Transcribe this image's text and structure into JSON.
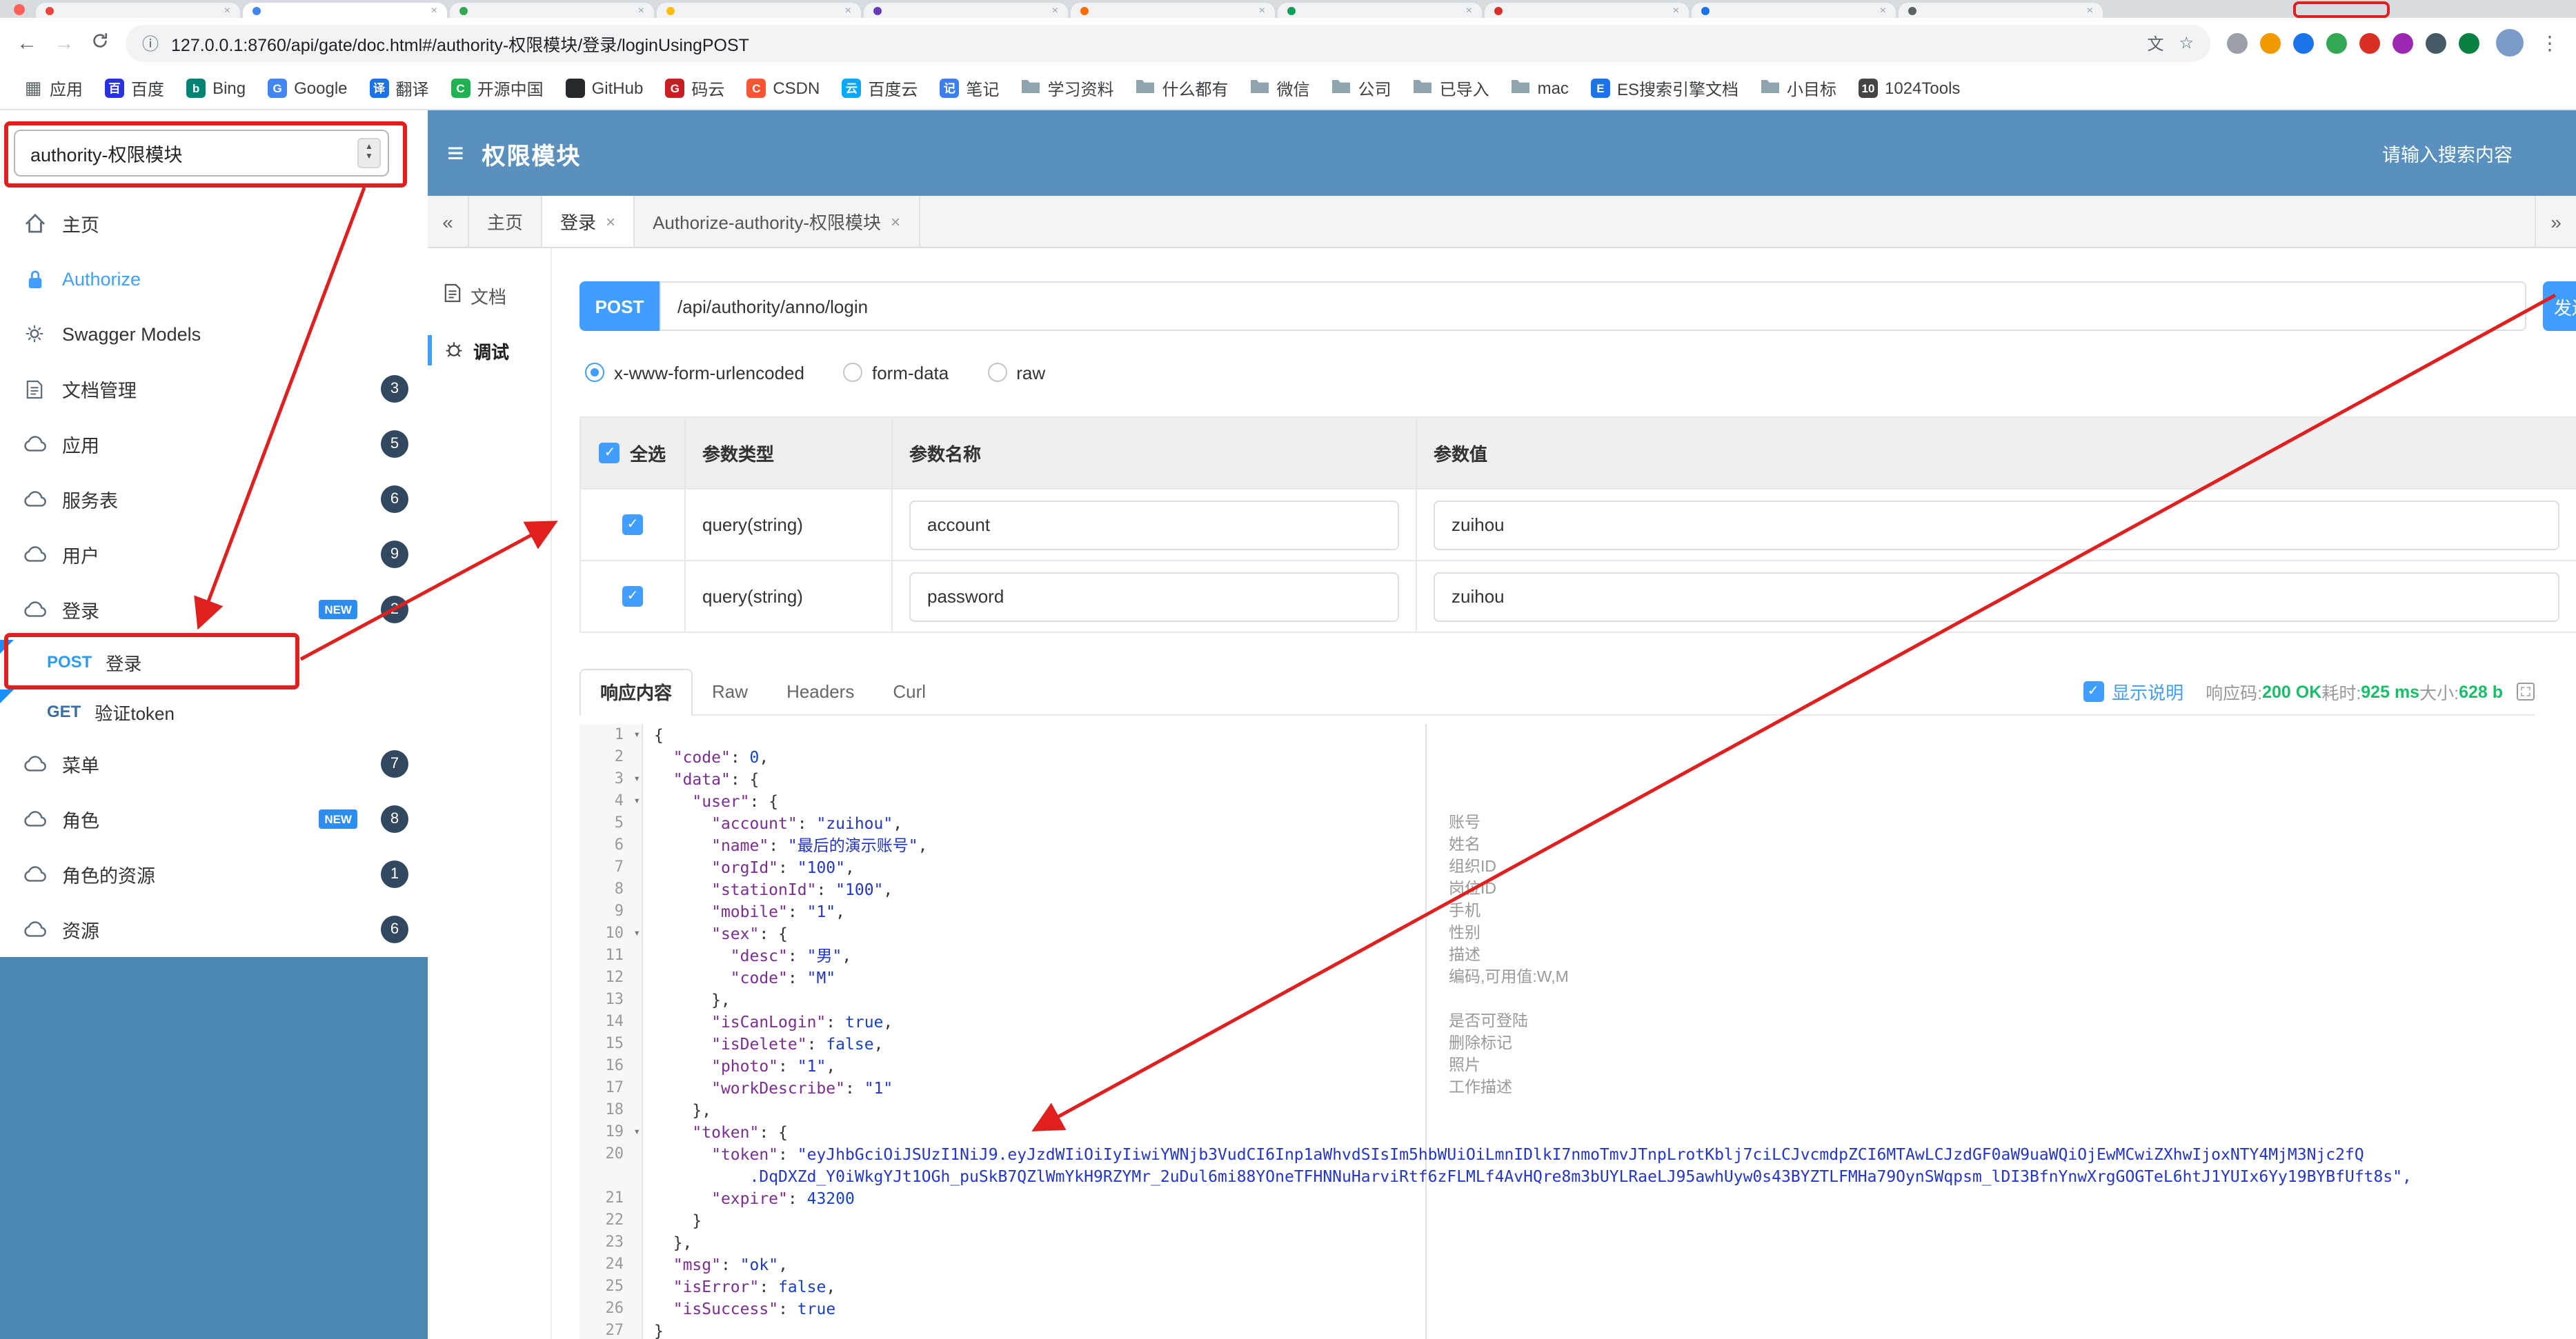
{
  "ui": {
    "burger": "≡",
    "collapse": "«",
    "expand": "»",
    "close": "×",
    "fold": "▾",
    "check": "✓",
    "back": "←",
    "forward": "→",
    "info": "ⓘ",
    "star": "☆",
    "translate": "文",
    "menu": "⋮",
    "apps": "▦",
    "spin_up": "▲",
    "spin_down": "▼"
  },
  "browser": {
    "url": "127.0.0.1:8760/api/gate/doc.html#/authority-权限模块/登录/loginUsingPOST",
    "bookmarks": [
      {
        "label": "应用",
        "icon": "grid"
      },
      {
        "label": "百度",
        "icon": "glyph",
        "bg": "#2932e1",
        "ch": "百"
      },
      {
        "label": "Bing",
        "icon": "glyph",
        "bg": "#008373",
        "ch": "b"
      },
      {
        "label": "Google",
        "icon": "glyph",
        "bg": "#4285f4",
        "ch": "G"
      },
      {
        "label": "翻译",
        "icon": "glyph",
        "bg": "#1a73e8",
        "ch": "译"
      },
      {
        "label": "开源中国",
        "icon": "glyph",
        "bg": "#21b351",
        "ch": "C"
      },
      {
        "label": "GitHub",
        "icon": "glyph",
        "bg": "#24292e",
        "ch": ""
      },
      {
        "label": "码云",
        "icon": "glyph",
        "bg": "#c71d23",
        "ch": "G"
      },
      {
        "label": "CSDN",
        "icon": "glyph",
        "bg": "#fc5531",
        "ch": "C"
      },
      {
        "label": "百度云",
        "icon": "glyph",
        "bg": "#06a7ff",
        "ch": "云"
      },
      {
        "label": "笔记",
        "icon": "glyph",
        "bg": "#3b7ff0",
        "ch": "记"
      },
      {
        "label": "学习资料",
        "icon": "folder"
      },
      {
        "label": "什么都有",
        "icon": "folder"
      },
      {
        "label": "微信",
        "icon": "folder"
      },
      {
        "label": "公司",
        "icon": "folder"
      },
      {
        "label": "已导入",
        "icon": "folder"
      },
      {
        "label": "mac",
        "icon": "folder"
      },
      {
        "label": "ES搜索引擎文档",
        "icon": "glyph",
        "bg": "#1a73e8",
        "ch": "E"
      },
      {
        "label": "小目标",
        "icon": "folder"
      },
      {
        "label": "1024Tools",
        "icon": "glyph",
        "bg": "#444444",
        "ch": "10"
      }
    ]
  },
  "header": {
    "group": "authority-权限模块",
    "title": "权限模块",
    "search_placeholder": "请输入搜索内容"
  },
  "sidebar": {
    "new_label": "NEW",
    "items": [
      {
        "label": "主页",
        "icon": "home"
      },
      {
        "label": "Authorize",
        "icon": "lock",
        "auth": true
      },
      {
        "label": "Swagger Models",
        "icon": "models"
      },
      {
        "label": "文档管理",
        "icon": "doc",
        "badge": "3"
      },
      {
        "label": "应用",
        "icon": "cloud",
        "badge": "5"
      },
      {
        "label": "服务表",
        "icon": "cloud",
        "badge": "6"
      },
      {
        "label": "用户",
        "icon": "cloud",
        "badge": "9"
      },
      {
        "label": "登录",
        "icon": "cloud",
        "badge": "2",
        "new": true
      },
      {
        "sub": true,
        "method": "POST",
        "label": "登录",
        "marker": true
      },
      {
        "sub": true,
        "method": "GET",
        "label": "验证token",
        "marker": true
      },
      {
        "label": "菜单",
        "icon": "cloud",
        "badge": "7"
      },
      {
        "label": "角色",
        "icon": "cloud",
        "badge": "8",
        "new": true
      },
      {
        "label": "角色的资源",
        "icon": "cloud",
        "badge": "1"
      },
      {
        "label": "资源",
        "icon": "cloud",
        "badge": "6"
      }
    ]
  },
  "content_tabs": {
    "items": [
      {
        "label": "主页"
      },
      {
        "label": "登录",
        "closable": true,
        "active": true
      },
      {
        "label": "Authorize-authority-权限模块",
        "closable": true
      }
    ]
  },
  "doc_nav": {
    "items": [
      {
        "label": "文档",
        "icon": "docpage"
      },
      {
        "label": "调试",
        "icon": "debug",
        "active": true
      }
    ]
  },
  "debug": {
    "method": "POST",
    "url": "/api/authority/anno/login",
    "send_label": "发送",
    "content_types": [
      {
        "label": "x-www-form-urlencoded",
        "selected": true
      },
      {
        "label": "form-data"
      },
      {
        "label": "raw"
      }
    ],
    "params": {
      "select_all": "全选",
      "headers": [
        "参数类型",
        "参数名称",
        "参数值"
      ],
      "rows": [
        {
          "checked": true,
          "type": "query(string)",
          "name": "account",
          "value": "zuihou"
        },
        {
          "checked": true,
          "type": "query(string)",
          "name": "password",
          "value": "zuihou"
        }
      ]
    }
  },
  "response": {
    "tabs": [
      {
        "label": "响应内容",
        "active": true
      },
      {
        "label": "Raw"
      },
      {
        "label": "Headers"
      },
      {
        "label": "Curl"
      }
    ],
    "show_desc": "显示说明",
    "status_label": "响应码:",
    "status": "200 OK",
    "time_label": "耗时:",
    "time": "925 ms",
    "size_label": "大小:",
    "size": "628 b"
  },
  "code": {
    "lines": [
      {
        "n": 1,
        "t": "{",
        "fold": true
      },
      {
        "n": 2,
        "t": "  \"code\": 0,"
      },
      {
        "n": 3,
        "t": "  \"data\": {",
        "fold": true
      },
      {
        "n": 4,
        "t": "    \"user\": {",
        "fold": true
      },
      {
        "n": 5,
        "t": "      \"account\": \"zuihou\",",
        "c": "账号"
      },
      {
        "n": 6,
        "t": "      \"name\": \"最后的演示账号\",",
        "c": "姓名"
      },
      {
        "n": 7,
        "t": "      \"orgId\": \"100\",",
        "c": "组织ID"
      },
      {
        "n": 8,
        "t": "      \"stationId\": \"100\",",
        "c": "岗位ID"
      },
      {
        "n": 9,
        "t": "      \"mobile\": \"1\",",
        "c": "手机"
      },
      {
        "n": 10,
        "t": "      \"sex\": {",
        "fold": true,
        "c": "性别"
      },
      {
        "n": 11,
        "t": "        \"desc\": \"男\",",
        "c": "描述"
      },
      {
        "n": 12,
        "t": "        \"code\": \"M\"",
        "c": "编码,可用值:W,M"
      },
      {
        "n": 13,
        "t": "      },"
      },
      {
        "n": 14,
        "t": "      \"isCanLogin\": true,",
        "c": "是否可登陆"
      },
      {
        "n": 15,
        "t": "      \"isDelete\": false,",
        "c": "删除标记"
      },
      {
        "n": 16,
        "t": "      \"photo\": \"1\",",
        "c": "照片"
      },
      {
        "n": 17,
        "t": "      \"workDescribe\": \"1\"",
        "c": "工作描述"
      },
      {
        "n": 18,
        "t": "    },"
      },
      {
        "n": 19,
        "t": "    \"token\": {",
        "fold": true
      },
      {
        "n": 20,
        "seg": [
          {
            "t": "      "
          },
          {
            "t": "\"token\"",
            "cls": "ck"
          },
          {
            "t": ": "
          },
          {
            "t": "\"eyJhbGciOiJSUzI1NiJ9.eyJzdWIiOiIyIiwiYWNjb3VudCI6Inp1aWhvdSIsIm5hbWUiOiLmnIDlkI7nmoTmvJTnpLrotKblj7ciLCJvcmdpZCI6MTAwLCJzdGF0aW9uaWQiOjEwMCwiZXhwIjoxNTY4MjM3Njc2fQ",
            "cls": "cs"
          }
        ]
      },
      {
        "n": "",
        "seg": [
          {
            "t": "          "
          },
          {
            "t": ".DqDXZd_Y0iWkgYJt1OGh_puSkB7QZlWmYkH9RZYMr_2uDul6mi88YOneTFHNNuHarviRtf6zFLMLf4AvHQre8m3bUYLRaeLJ95awhUyw0s43BYZTLFMHa79OynSWqpsm_lDI3BfnYnwXrgGOGTeL6htJ1YUIx6Yy19BYBfUft8s\",",
            "cls": "cs"
          }
        ]
      },
      {
        "n": 21,
        "t": "      \"expire\": 43200"
      },
      {
        "n": 22,
        "t": "    }"
      },
      {
        "n": 23,
        "t": "  },"
      },
      {
        "n": 24,
        "t": "  \"msg\": \"ok\","
      },
      {
        "n": 25,
        "t": "  \"isError\": false,"
      },
      {
        "n": 26,
        "t": "  \"isSuccess\": true"
      },
      {
        "n": 27,
        "t": "}"
      }
    ]
  }
}
